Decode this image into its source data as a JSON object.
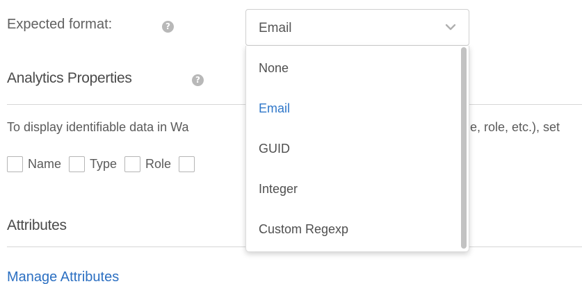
{
  "form": {
    "expected_format_label": "Expected format:",
    "help_glyph": "?",
    "select": {
      "value": "Email",
      "chevron_icon": "chevron-down-icon"
    },
    "dropdown": {
      "options": [
        "None",
        "Email",
        "GUID",
        "Integer",
        "Custom Regexp"
      ],
      "selected": "Email"
    }
  },
  "analytics": {
    "title": "Analytics Properties",
    "description_left": "To display identifiable data in Wa",
    "description_right": "e, role, etc.), set",
    "checkboxes": [
      "Name",
      "Type",
      "Role",
      ""
    ]
  },
  "attributes": {
    "title": "Attributes",
    "manage_link": "Manage Attributes"
  },
  "colors": {
    "link": "#2b6fc2",
    "selected_option": "#2f77c9",
    "help_icon": "#b8b8b8"
  }
}
